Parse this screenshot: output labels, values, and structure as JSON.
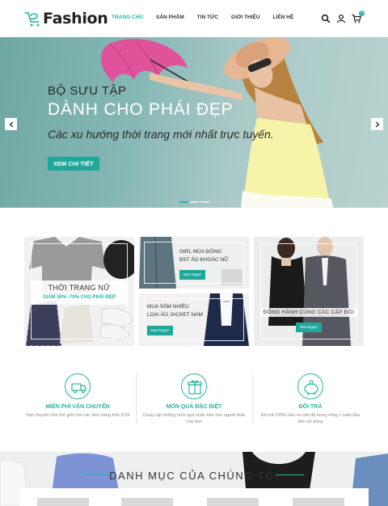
{
  "brand": {
    "logo_text": "Fashion",
    "accent": "#2ab3a3"
  },
  "nav": {
    "items": [
      {
        "label": "TRANG CHỦ",
        "active": true
      },
      {
        "label": "SẢN PHẨM",
        "active": false
      },
      {
        "label": "TIN TỨC",
        "active": false
      },
      {
        "label": "GIỚI THIỆU",
        "active": false
      },
      {
        "label": "LIÊN HỆ",
        "active": false
      }
    ],
    "icons": [
      "search-icon",
      "user-icon",
      "cart-icon"
    ],
    "cart_count": "0"
  },
  "hero": {
    "kicker": "BỘ SƯU TẬP",
    "title": "DÀNH CHO PHÁI ĐẸP",
    "subtitle": "Các xu hướng thời trang mới nhất trực tuyến.",
    "button": "XEM CHI TIẾT",
    "slides": 3,
    "active_slide": 1
  },
  "promos": {
    "women": {
      "title": "THỜI TRANG NỮ",
      "subtitle": "GIẢM 50% -70% CHO PHÁI ĐẸP"
    },
    "jacket": {
      "line1": "GIRL MÙA ĐÔNG",
      "line2": "BST ÁO KHOÁC NỮ",
      "button": "Mua Ngay!"
    },
    "shopping": {
      "line1": "MUA SẮM NHIỀU",
      "line2": "LOẠI ÁO JACKET NAM",
      "button": "Mua Ngay!"
    },
    "couple": {
      "title": "ĐỒNG HÀNH CÙNG CÁC CẶP ĐÔI",
      "button": "Mua Ngay!"
    }
  },
  "features": [
    {
      "icon": "truck-icon",
      "title": "MIỄN PHÍ VẬN CHUYỂN",
      "desc": "Vận chuyển trên thế giới cho các đơn hàng trên $ 99"
    },
    {
      "icon": "gift-icon",
      "title": "MÓN QUÀ ĐẶC BIỆT",
      "desc": "Cung cấp những món quà hoàn hảo cho người thân của bạn"
    },
    {
      "icon": "piggy-bank-icon",
      "title": "ĐỔI TRẢ",
      "desc": "Đổi trả 100% nếu có vấn đề trong vòng 1 tuần đầu tiên sử dụng"
    }
  ],
  "category": {
    "title": "DANH MỤC CỦA CHÚNG TÔI"
  }
}
